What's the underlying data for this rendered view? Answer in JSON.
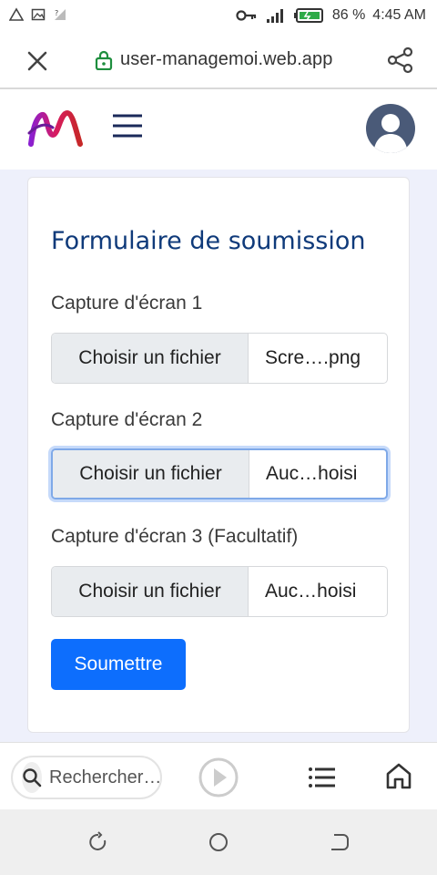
{
  "status_bar": {
    "battery": "86 %",
    "time": "4:45 AM"
  },
  "browser": {
    "url": "user-managemoi.web.app"
  },
  "app_header": {
    "logo": "brand-logo",
    "menu_icon": "hamburger-icon",
    "avatar_icon": "user-avatar-icon"
  },
  "form": {
    "title": "Formulaire de soumission",
    "fields": [
      {
        "label": "Capture d'écran 1",
        "button": "Choisir un fichier",
        "filename": "Scre….png",
        "focused": false
      },
      {
        "label": "Capture d'écran 2",
        "button": "Choisir un fichier",
        "filename": "Auc…hoisi",
        "focused": true
      },
      {
        "label": "Capture d'écran 3 (Facultatif)",
        "button": "Choisir un fichier",
        "filename": "Auc…hoisi",
        "focused": false
      }
    ],
    "submit_label": "Soumettre"
  },
  "bottom_toolbar": {
    "search_placeholder": "Rechercher…"
  },
  "colors": {
    "accent": "#0d6efd",
    "title": "#0f3a7a",
    "page_bg": "#eef0fb"
  }
}
